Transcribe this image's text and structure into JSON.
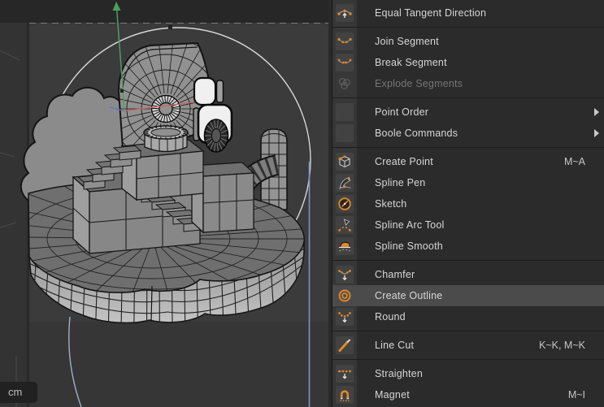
{
  "viewport": {
    "unit_label": "cm"
  },
  "menu": {
    "items": [
      {
        "id": "equal-tangent-direction",
        "label": "Equal Tangent Direction",
        "icon": "equal-tangent-direction"
      },
      {
        "type": "separator"
      },
      {
        "id": "join-segment",
        "label": "Join Segment",
        "icon": "join-segment"
      },
      {
        "id": "break-segment",
        "label": "Break Segment",
        "icon": "break-segment"
      },
      {
        "id": "explode-segments",
        "label": "Explode Segments",
        "icon": "explode-segments",
        "disabled": true
      },
      {
        "type": "separator"
      },
      {
        "id": "point-order",
        "label": "Point Order",
        "icon": "none",
        "submenu": true
      },
      {
        "id": "boole-commands",
        "label": "Boole Commands",
        "icon": "none",
        "submenu": true
      },
      {
        "type": "separator"
      },
      {
        "id": "create-point",
        "label": "Create Point",
        "icon": "create-point",
        "shortcut": "M~A"
      },
      {
        "id": "spline-pen",
        "label": "Spline Pen",
        "icon": "spline-pen"
      },
      {
        "id": "sketch",
        "label": "Sketch",
        "icon": "sketch"
      },
      {
        "id": "spline-arc-tool",
        "label": "Spline Arc Tool",
        "icon": "spline-arc-tool"
      },
      {
        "id": "spline-smooth",
        "label": "Spline Smooth",
        "icon": "spline-smooth"
      },
      {
        "type": "separator"
      },
      {
        "id": "chamfer",
        "label": "Chamfer",
        "icon": "chamfer"
      },
      {
        "id": "create-outline",
        "label": "Create Outline",
        "icon": "create-outline",
        "highlighted": true
      },
      {
        "id": "round",
        "label": "Round",
        "icon": "round"
      },
      {
        "type": "separator"
      },
      {
        "id": "line-cut",
        "label": "Line Cut",
        "icon": "line-cut",
        "shortcut": "K~K, M~K"
      },
      {
        "type": "separator"
      },
      {
        "id": "straighten",
        "label": "Straighten",
        "icon": "straighten"
      },
      {
        "id": "magnet",
        "label": "Magnet",
        "icon": "magnet",
        "shortcut": "M~I"
      }
    ]
  },
  "colors": {
    "accent_orange": "#E0882A",
    "menu_bg": "#2B2B2B",
    "menu_icon_strip": "#373737",
    "menu_icon_cell": "#424242",
    "menu_highlight": "#4B4B4B",
    "menu_text": "#D6D6D6",
    "menu_text_disabled": "#757575",
    "menu_separator": "#1D1D1D",
    "viewport_bg": "#3B3B3B",
    "top_strip": "#272727",
    "side_panel": "#333333",
    "axis_x_red": "#D06060",
    "axis_y_green": "#4E9E5C",
    "axis_z_blue": "#5C77C2",
    "spline_white": "#D9D9D9",
    "guide_blue": "#7E95C3",
    "unit_chip_bg": "#212121",
    "unit_chip_text": "#BDBDBD"
  }
}
